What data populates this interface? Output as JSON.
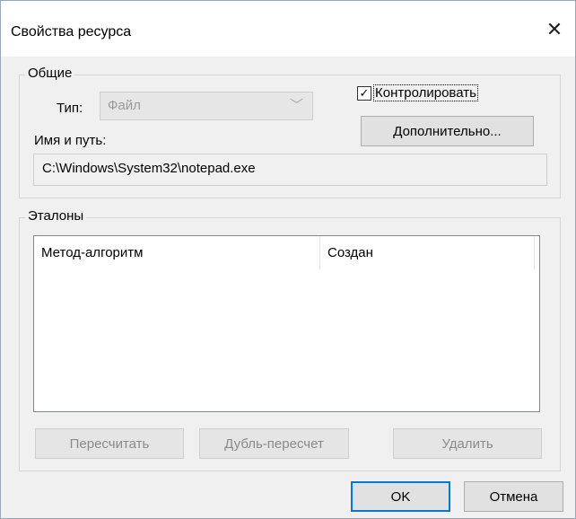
{
  "window": {
    "title": "Свойства ресурса",
    "close_glyph": "✕"
  },
  "general": {
    "legend": "Общие",
    "type_label": "Тип:",
    "type_value": "Файл",
    "control_label": "Контролировать",
    "control_checked": true,
    "advanced_button": "Дополнительно...",
    "path_label": "Имя и путь:",
    "path_value": "C:\\Windows\\System32\\notepad.exe"
  },
  "etalons": {
    "legend": "Эталоны",
    "columns": [
      "Метод-алгоритм",
      "Создан"
    ],
    "rows": [],
    "buttons": {
      "recalc": "Пересчитать",
      "dup_recalc": "Дубль-пересчет",
      "delete": "Удалить"
    }
  },
  "footer": {
    "ok": "OK",
    "cancel": "Отмена"
  },
  "colors": {
    "dialog_bg": "#f0f0f0",
    "accent_focus": "#0078d7"
  },
  "icons": {
    "close": "close-icon",
    "dropdown": "chevron-down-icon",
    "check": "checkmark-icon"
  }
}
